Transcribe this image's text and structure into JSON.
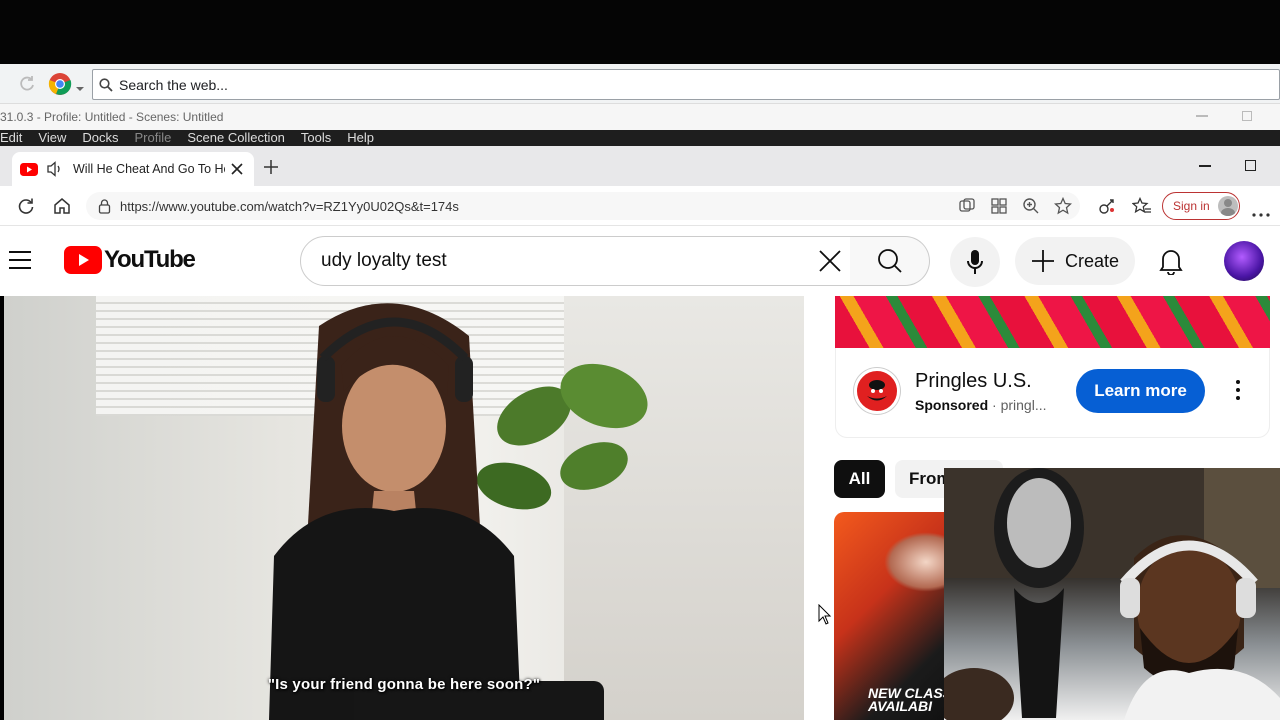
{
  "outer_browser": {
    "omnibox_placeholder": "Search the web..."
  },
  "obs": {
    "title": "31.0.3 - Profile: Untitled - Scenes: Untitled",
    "menu": [
      "Edit",
      "View",
      "Docks",
      "Profile",
      "Scene Collection",
      "Tools",
      "Help"
    ]
  },
  "edge": {
    "tab_title": "Will He Cheat And Go To He",
    "url": "https://www.youtube.com/watch?v=RZ1Yy0U02Qs&t=174s",
    "sign_in": "Sign in"
  },
  "youtube": {
    "logo_text": "YouTube",
    "search_value": "udy loyalty test",
    "create_label": "Create",
    "video_subtitle": "\"Is your friend gonna be here soon?\"",
    "ad": {
      "advertiser": "Pringles U.S.",
      "sponsored": "Sponsored",
      "domain": "pringl...",
      "cta": "Learn more"
    },
    "chips": [
      "All",
      "From"
    ],
    "thumb_text": "NEW CLASS AVAILABI"
  },
  "colors": {
    "yt_red": "#ff0000",
    "cta_blue": "#065fd4",
    "signin_red": "#b33333"
  }
}
